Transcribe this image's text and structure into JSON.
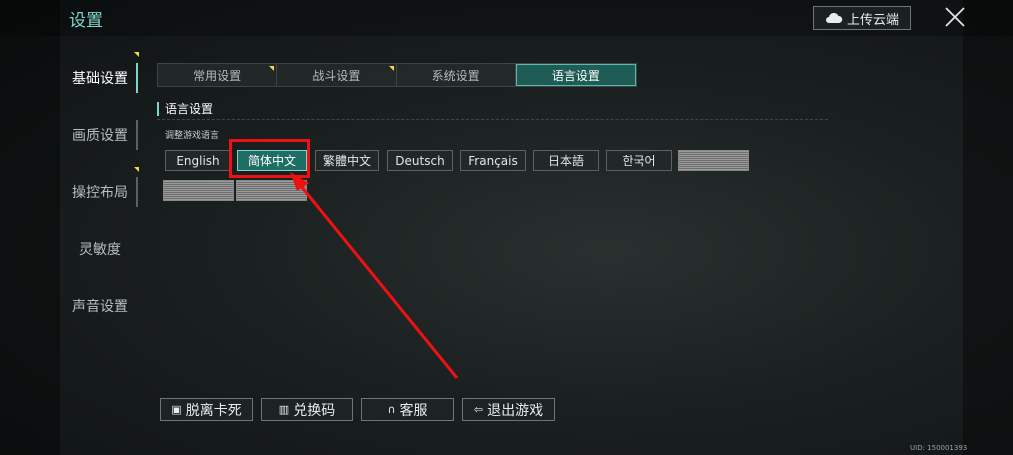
{
  "header": {
    "title": "设置",
    "upload_label": "上传云端"
  },
  "sidebar": {
    "items": [
      {
        "label": "基础设置",
        "active": true
      },
      {
        "label": "画质设置",
        "active": false
      },
      {
        "label": "操控布局",
        "active": false
      },
      {
        "label": "灵敏度",
        "active": false
      },
      {
        "label": "声音设置",
        "active": false
      }
    ]
  },
  "tabs": [
    {
      "label": "常用设置",
      "active": false
    },
    {
      "label": "战斗设置",
      "active": false
    },
    {
      "label": "系统设置",
      "active": false
    },
    {
      "label": "语言设置",
      "active": true
    }
  ],
  "section": {
    "title": "语言设置",
    "sub_label": "调整游戏语言"
  },
  "languages": [
    {
      "label": "English"
    },
    {
      "label": "简体中文",
      "selected": true
    },
    {
      "label": "繁體中文"
    },
    {
      "label": "Deutsch"
    },
    {
      "label": "Français"
    },
    {
      "label": "日本語"
    },
    {
      "label": "한국어"
    }
  ],
  "bottom_buttons": [
    {
      "label": "脱离卡死",
      "icon": "stuck-icon"
    },
    {
      "label": "兑换码",
      "icon": "barcode-icon"
    },
    {
      "label": "客服",
      "icon": "headset-icon"
    },
    {
      "label": "退出游戏",
      "icon": "exit-icon"
    }
  ],
  "uid": "UID: 150001393",
  "colors": {
    "accent": "#7fd6cc",
    "highlight": "#ee1111",
    "marker": "#f5d84a"
  }
}
